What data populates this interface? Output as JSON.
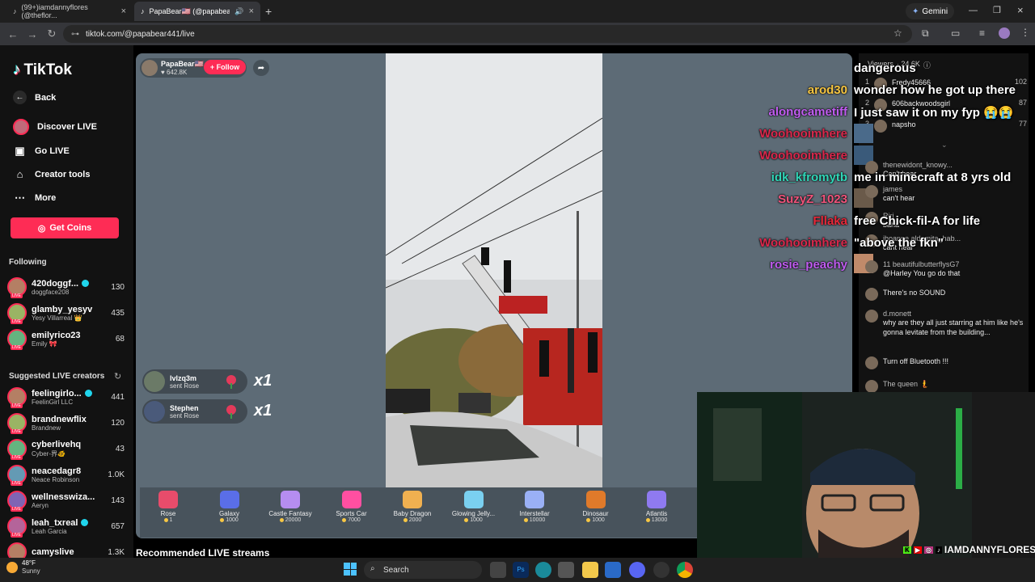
{
  "browser": {
    "tabs": [
      {
        "title": "(99+)iamdannyflores (@theflor..."
      },
      {
        "title": "PapaBear🇺🇸 (@papabear44..."
      }
    ],
    "profile_button": "Gemini",
    "url": "tiktok.com/@papabear441/live"
  },
  "sidebar": {
    "logo": "TikTok",
    "nav": [
      {
        "label": "Back",
        "icon": "arrow-left-icon"
      },
      {
        "label": "Discover LIVE",
        "icon": "live-avatar-icon"
      },
      {
        "label": "Go LIVE",
        "icon": "camera-icon"
      },
      {
        "label": "Creator tools",
        "icon": "home-icon"
      },
      {
        "label": "More",
        "icon": "ellipsis-icon"
      }
    ],
    "get_coins": "Get Coins",
    "following_title": "Following",
    "following": [
      {
        "name": "420doggf...",
        "sub": "doggface208",
        "count": "130",
        "verified": true
      },
      {
        "name": "glamby_yesyv",
        "sub": "Yesy Villarreal 👑",
        "count": "435",
        "verified": false
      },
      {
        "name": "emilyrico23",
        "sub": "Emily 🎀",
        "count": "68",
        "verified": false
      }
    ],
    "suggested_title": "Suggested LIVE creators",
    "suggested": [
      {
        "name": "feelingirlo...",
        "sub": "FeelinGirl LLC",
        "count": "441",
        "verified": true
      },
      {
        "name": "brandnewflix",
        "sub": "Brandnew",
        "count": "120",
        "verified": false
      },
      {
        "name": "cyberlivehq",
        "sub": "Cyber-界🐠",
        "count": "43",
        "verified": false
      },
      {
        "name": "neacedagr8",
        "sub": "Neace Robinson",
        "count": "1.0K",
        "verified": false
      },
      {
        "name": "wellnesswiza...",
        "sub": "Aeryn",
        "count": "143",
        "verified": false
      },
      {
        "name": "leah_txreal",
        "sub": "Leah Garcia",
        "count": "657",
        "verified": true
      },
      {
        "name": "camyslive",
        "sub": "",
        "count": "1.3K",
        "verified": false
      }
    ]
  },
  "live": {
    "host_name": "PapaBear🇺🇸",
    "host_likes": "642.8K",
    "follow": "+ Follow",
    "gift_notes": [
      {
        "user": "lvlzq3m",
        "action": "sent Rose",
        "multiplier": "x1"
      },
      {
        "user": "Stephen",
        "action": "sent Rose",
        "multiplier": "x1"
      }
    ],
    "gifts": [
      {
        "name": "Rose",
        "price": "1",
        "color": "#e84c6b"
      },
      {
        "name": "Galaxy",
        "price": "1000",
        "color": "#5a6ee8"
      },
      {
        "name": "Castle Fantasy",
        "price": "20000",
        "color": "#b58df0"
      },
      {
        "name": "Sports Car",
        "price": "7000",
        "color": "#ff4fa1"
      },
      {
        "name": "Baby Dragon",
        "price": "2000",
        "color": "#f0b050"
      },
      {
        "name": "Glowing Jelly...",
        "price": "1000",
        "color": "#7ad0f0"
      },
      {
        "name": "Interstellar",
        "price": "10000",
        "color": "#9ab0f5"
      },
      {
        "name": "Dinosaur",
        "price": "1000",
        "color": "#e07a2a"
      },
      {
        "name": "Atlantis",
        "price": "13000",
        "color": "#8f7af0"
      }
    ],
    "recommended": "Recommended LIVE streams"
  },
  "chat": {
    "viewers_label": "Viewers",
    "viewers_count": "24.6K",
    "top_viewers": [
      {
        "rank": "1",
        "name": "Fredy45666",
        "score": "102"
      },
      {
        "rank": "2",
        "name": "606backwoodsgirl",
        "score": "87"
      },
      {
        "rank": "3",
        "name": "napsho",
        "score": "77"
      }
    ],
    "messages": [
      {
        "name": "thenewidont_knowy...",
        "text": "Can't hear"
      },
      {
        "name": "james",
        "text": "can't hear"
      },
      {
        "name": "Riri",
        "text": "baha"
      },
      {
        "name": "jhoanne.aldemita_hab...",
        "text": "cant hear"
      },
      {
        "name": "11 beautifulbutterflysG7",
        "text": "@Harley You go do that"
      },
      {
        "name": "",
        "text": "There's no SOUND"
      },
      {
        "name": "d.monett",
        "text": "why are they all just starring at him like he's gonna levitate from the building..."
      },
      {
        "name": "",
        "text": "Turn off Bluetooth !!!"
      },
      {
        "name": "The queen 🧜",
        "text": ""
      }
    ]
  },
  "overlay_chat": {
    "users": [
      {
        "name": "arod30",
        "color": "#f5c542"
      },
      {
        "name": "alongcametiff",
        "color": "#c05cf0"
      },
      {
        "name": "Woohooimhere",
        "color": "#d9284c"
      },
      {
        "name": "Woohooimhere",
        "color": "#d9284c"
      },
      {
        "name": "idk_kfromytb",
        "color": "#31d6b8"
      },
      {
        "name": "SuzyZ_1023",
        "color": "#f0537a"
      },
      {
        "name": "Fllaka",
        "color": "#e8283a"
      },
      {
        "name": "Woohooimhere",
        "color": "#d9284c"
      },
      {
        "name": "rosie_peachy",
        "color": "#c05cf0"
      }
    ],
    "messages": [
      "dangerous",
      "wonder how he got up there",
      "I just saw it on my fyp 😭😭",
      "me in minecraft at 8 yrs old",
      "free Chick-fil-A for life",
      "\"above the fkn\""
    ]
  },
  "webcam": {
    "handle": "IAMDANNYFLORES"
  },
  "taskbar": {
    "temp": "48°F",
    "condition": "Sunny",
    "search": "Search"
  }
}
